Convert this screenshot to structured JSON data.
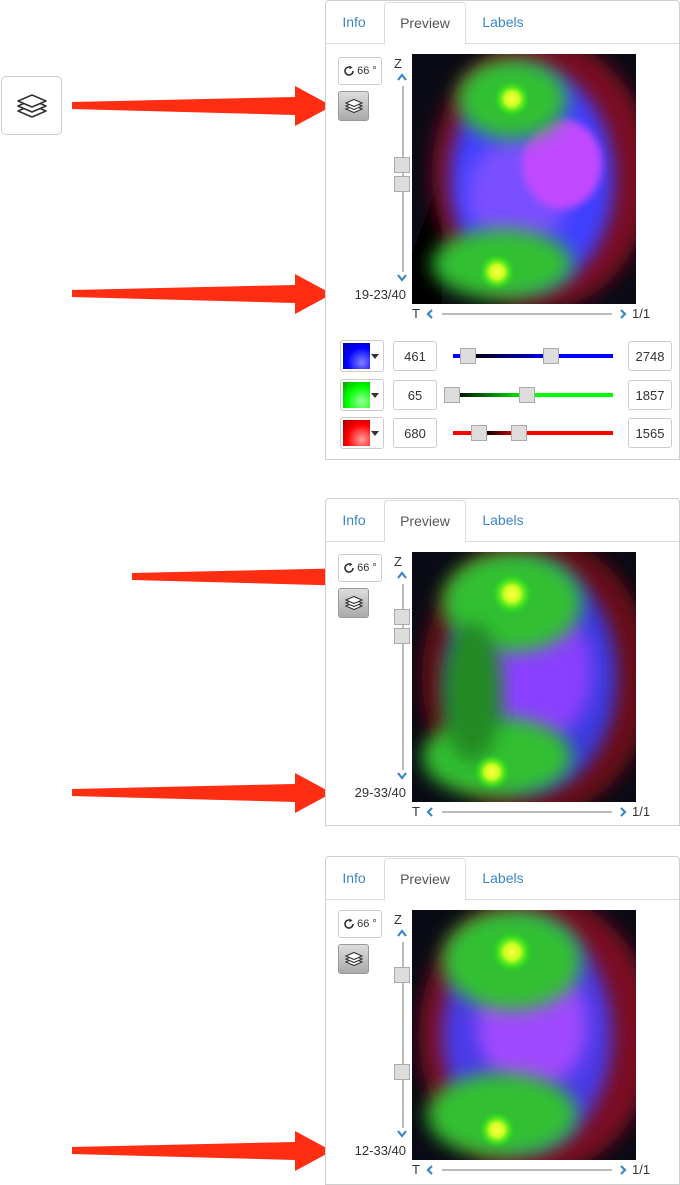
{
  "tabs": [
    "Info",
    "Preview",
    "Labels"
  ],
  "axis": {
    "z_label": "Z",
    "t_label": "T"
  },
  "rotation_label": "66 °",
  "panels": [
    {
      "z_range": "19-23/40",
      "t_value": "1/1",
      "z_handles": [
        0.35,
        0.42
      ]
    },
    {
      "z_range": "29-33/40",
      "t_value": "1/1",
      "z_handles": [
        0.17,
        0.25
      ]
    },
    {
      "z_range": "12-33/40",
      "t_value": "1/1",
      "z_handles": [
        0.23,
        0.82
      ]
    }
  ],
  "channels": [
    {
      "color": "#0000ff",
      "min": "461",
      "max": "2748",
      "start_fraction": 0.1,
      "end_fraction": 0.62
    },
    {
      "color": "#00ff00",
      "min": "65",
      "max": "1857",
      "start_fraction": 0.0,
      "end_fraction": 0.47
    },
    {
      "color": "#ff0000",
      "min": "680",
      "max": "1565",
      "start_fraction": 0.17,
      "end_fraction": 0.42
    }
  ],
  "icons": [
    "layers-icon",
    "rotate-icon",
    "chevron-up-icon",
    "chevron-down-icon",
    "chevron-left-icon",
    "chevron-right-icon",
    "arrow-icon"
  ],
  "colors": {
    "link": "#3a87c8",
    "arrow": "#ff2d12"
  }
}
